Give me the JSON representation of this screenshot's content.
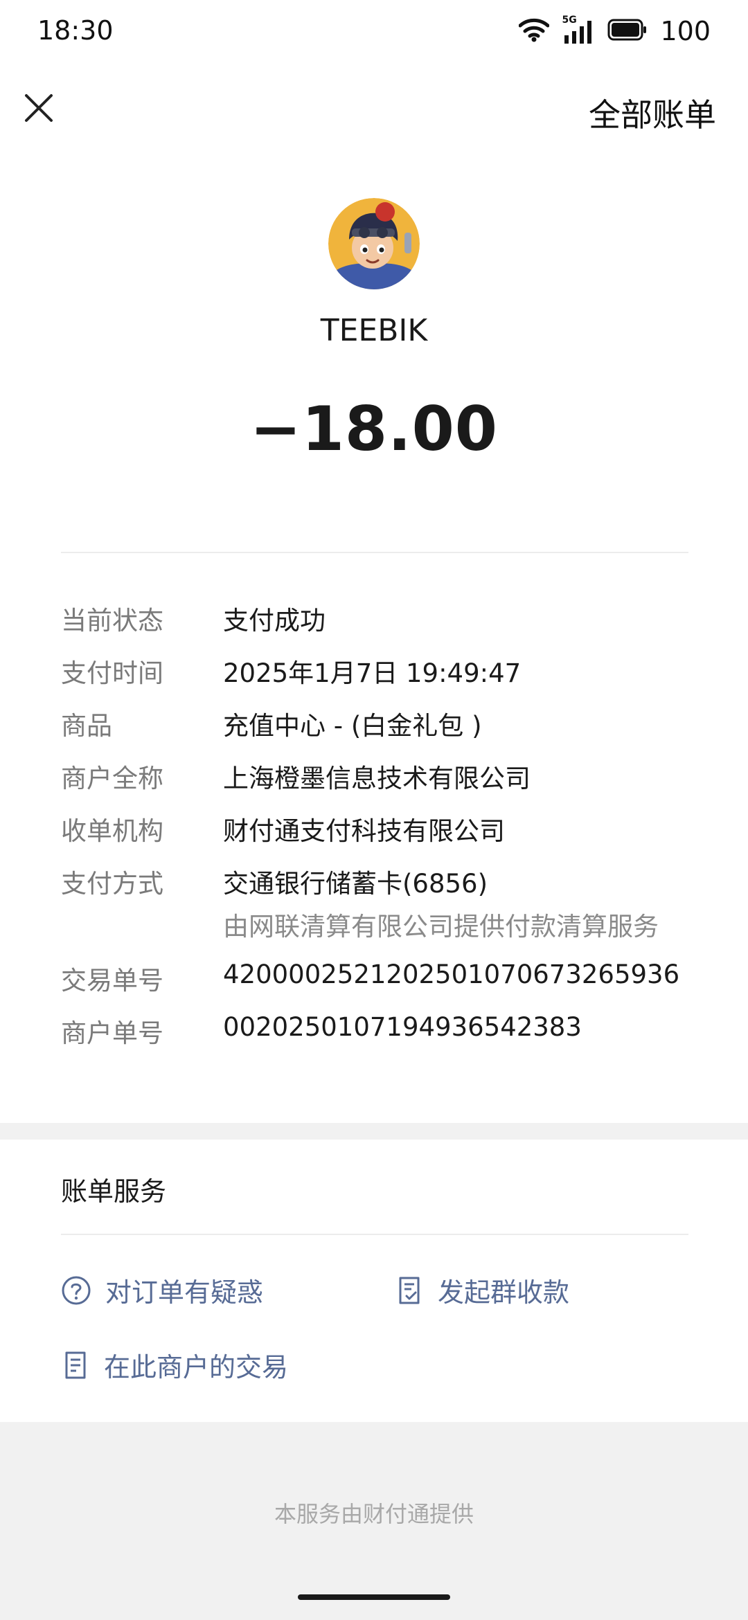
{
  "status_bar": {
    "time": "18:30",
    "network": "5G",
    "battery": "100"
  },
  "header": {
    "close_icon": "close-icon",
    "all_bills_label": "全部账单"
  },
  "merchant": {
    "name": "TEEBIK",
    "amount": "−18.00"
  },
  "details": [
    {
      "label": "当前状态",
      "value": "支付成功"
    },
    {
      "label": "支付时间",
      "value": "2025年1月7日 19:49:47"
    },
    {
      "label": "商品",
      "value": "充值中心 - (白金礼包 )"
    },
    {
      "label": "商户全称",
      "value": "上海橙墨信息技术有限公司"
    },
    {
      "label": "收单机构",
      "value": "财付通支付科技有限公司"
    },
    {
      "label": "支付方式",
      "value": "交通银行储蓄卡(6856)",
      "sub": "由网联清算有限公司提供付款清算服务"
    },
    {
      "label": "交易单号",
      "value": "4200002521202501070673265936"
    },
    {
      "label": "商户单号",
      "value": "0020250107194936542383"
    }
  ],
  "services": {
    "title": "账单服务",
    "items": [
      {
        "label": "对订单有疑惑",
        "icon": "question-circle-icon"
      },
      {
        "label": "发起群收款",
        "icon": "checklist-doc-icon"
      },
      {
        "label": "在此商户的交易",
        "icon": "document-icon"
      }
    ]
  },
  "footer": {
    "text": "本服务由财付通提供"
  },
  "colors": {
    "link": "#576b95",
    "label": "#7a7a7a",
    "band": "#f1f1f1"
  }
}
